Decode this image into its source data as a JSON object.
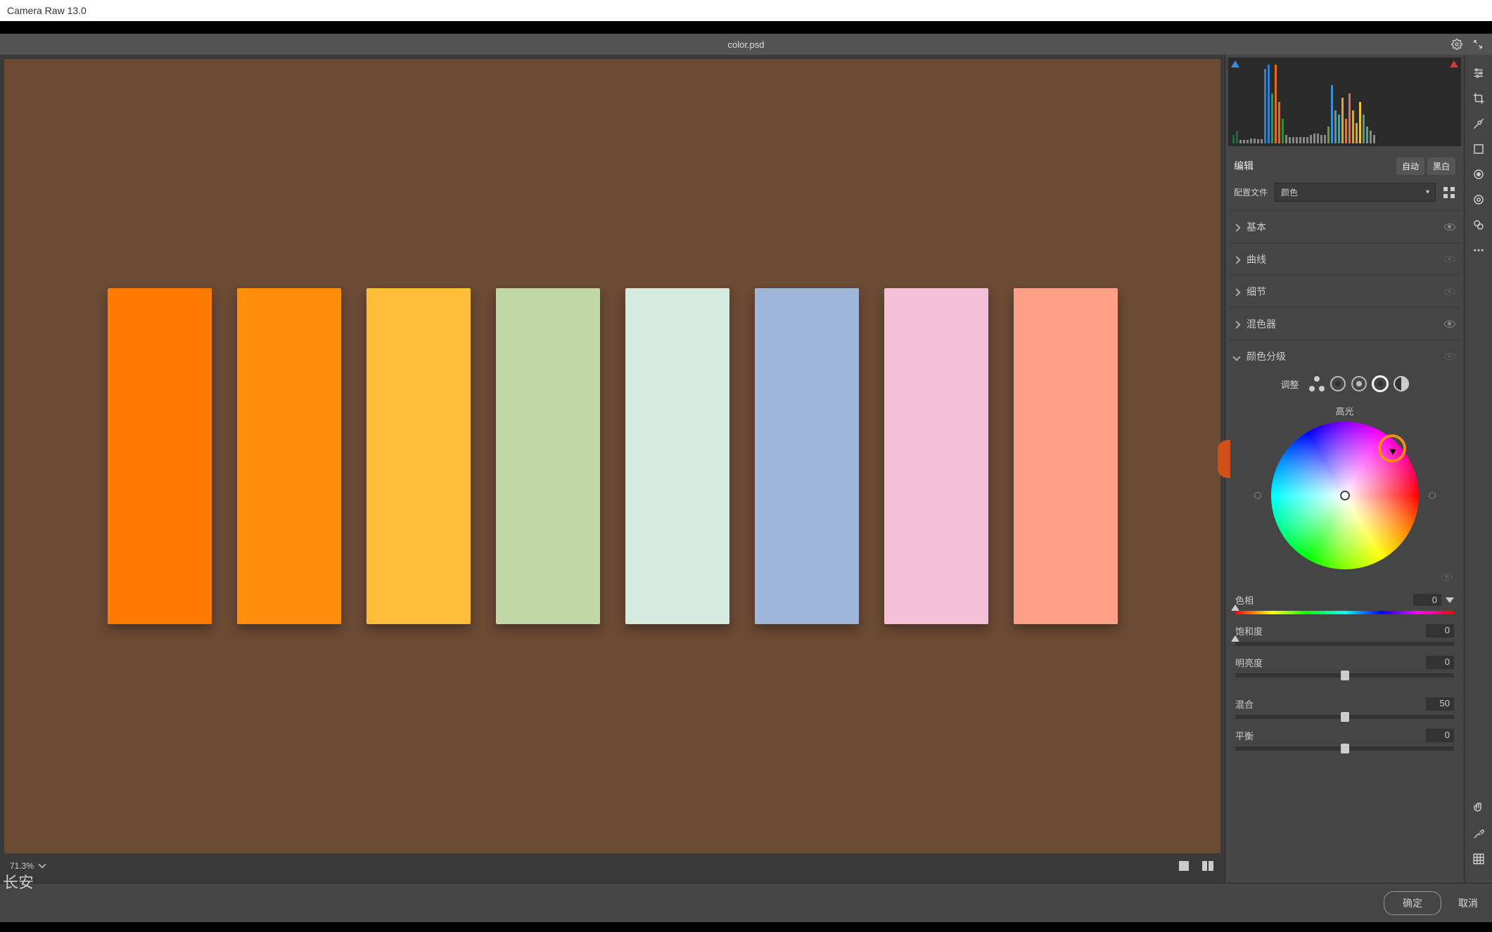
{
  "app_title": "Camera Raw 13.0",
  "document_name": "color.psd",
  "zoom_level": "71.3%",
  "watermark_text": "长安",
  "swatches": [
    {
      "color": "#ff7a00"
    },
    {
      "color": "#ff8e0d"
    },
    {
      "color": "#ffbe3a"
    },
    {
      "color": "#c2d7a6"
    },
    {
      "color": "#d5ebe0"
    },
    {
      "color": "#9eb6da"
    },
    {
      "color": "#f3c0d8"
    },
    {
      "color": "#ff9f87"
    }
  ],
  "panel": {
    "edit_label": "编辑",
    "auto_btn": "自动",
    "bw_btn": "黑白",
    "profile_label": "配置文件",
    "profile_value": "颜色",
    "sections": {
      "basic": "基本",
      "curve": "曲线",
      "detail": "细节",
      "mixer": "混色器",
      "color_grading": "颜色分级"
    },
    "color_grading": {
      "adjust_label": "调整",
      "wheel_label": "高光",
      "sliders": {
        "hue": {
          "label": "色相",
          "value": "0"
        },
        "saturation": {
          "label": "饱和度",
          "value": "0"
        },
        "luminance": {
          "label": "明亮度",
          "value": "0"
        },
        "blend": {
          "label": "混合",
          "value": "50"
        },
        "balance": {
          "label": "平衡",
          "value": "0"
        }
      }
    }
  },
  "footer": {
    "ok": "确定",
    "cancel": "取消"
  }
}
